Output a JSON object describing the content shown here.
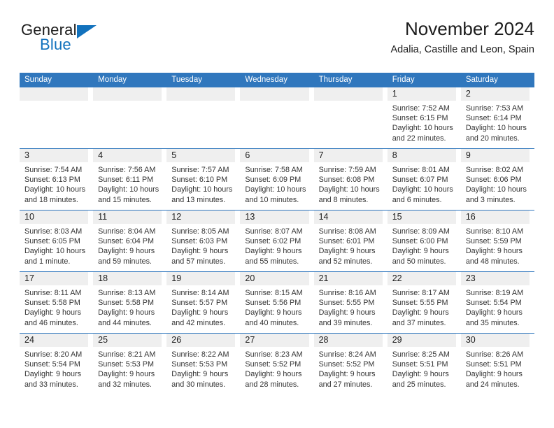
{
  "brand": {
    "name_part1": "General",
    "name_part2": "Blue",
    "accent_color": "#1272bd"
  },
  "header": {
    "title": "November 2024",
    "subtitle": "Adalia, Castille and Leon, Spain"
  },
  "calendar": {
    "header_bg": "#3077bd",
    "daynum_bg": "#efefef",
    "day_names": [
      "Sunday",
      "Monday",
      "Tuesday",
      "Wednesday",
      "Thursday",
      "Friday",
      "Saturday"
    ],
    "weeks": [
      [
        {
          "empty": true
        },
        {
          "empty": true
        },
        {
          "empty": true
        },
        {
          "empty": true
        },
        {
          "empty": true
        },
        {
          "day": "1",
          "sunrise": "Sunrise: 7:52 AM",
          "sunset": "Sunset: 6:15 PM",
          "daylight1": "Daylight: 10 hours",
          "daylight2": "and 22 minutes."
        },
        {
          "day": "2",
          "sunrise": "Sunrise: 7:53 AM",
          "sunset": "Sunset: 6:14 PM",
          "daylight1": "Daylight: 10 hours",
          "daylight2": "and 20 minutes."
        }
      ],
      [
        {
          "day": "3",
          "sunrise": "Sunrise: 7:54 AM",
          "sunset": "Sunset: 6:13 PM",
          "daylight1": "Daylight: 10 hours",
          "daylight2": "and 18 minutes."
        },
        {
          "day": "4",
          "sunrise": "Sunrise: 7:56 AM",
          "sunset": "Sunset: 6:11 PM",
          "daylight1": "Daylight: 10 hours",
          "daylight2": "and 15 minutes."
        },
        {
          "day": "5",
          "sunrise": "Sunrise: 7:57 AM",
          "sunset": "Sunset: 6:10 PM",
          "daylight1": "Daylight: 10 hours",
          "daylight2": "and 13 minutes."
        },
        {
          "day": "6",
          "sunrise": "Sunrise: 7:58 AM",
          "sunset": "Sunset: 6:09 PM",
          "daylight1": "Daylight: 10 hours",
          "daylight2": "and 10 minutes."
        },
        {
          "day": "7",
          "sunrise": "Sunrise: 7:59 AM",
          "sunset": "Sunset: 6:08 PM",
          "daylight1": "Daylight: 10 hours",
          "daylight2": "and 8 minutes."
        },
        {
          "day": "8",
          "sunrise": "Sunrise: 8:01 AM",
          "sunset": "Sunset: 6:07 PM",
          "daylight1": "Daylight: 10 hours",
          "daylight2": "and 6 minutes."
        },
        {
          "day": "9",
          "sunrise": "Sunrise: 8:02 AM",
          "sunset": "Sunset: 6:06 PM",
          "daylight1": "Daylight: 10 hours",
          "daylight2": "and 3 minutes."
        }
      ],
      [
        {
          "day": "10",
          "sunrise": "Sunrise: 8:03 AM",
          "sunset": "Sunset: 6:05 PM",
          "daylight1": "Daylight: 10 hours",
          "daylight2": "and 1 minute."
        },
        {
          "day": "11",
          "sunrise": "Sunrise: 8:04 AM",
          "sunset": "Sunset: 6:04 PM",
          "daylight1": "Daylight: 9 hours",
          "daylight2": "and 59 minutes."
        },
        {
          "day": "12",
          "sunrise": "Sunrise: 8:05 AM",
          "sunset": "Sunset: 6:03 PM",
          "daylight1": "Daylight: 9 hours",
          "daylight2": "and 57 minutes."
        },
        {
          "day": "13",
          "sunrise": "Sunrise: 8:07 AM",
          "sunset": "Sunset: 6:02 PM",
          "daylight1": "Daylight: 9 hours",
          "daylight2": "and 55 minutes."
        },
        {
          "day": "14",
          "sunrise": "Sunrise: 8:08 AM",
          "sunset": "Sunset: 6:01 PM",
          "daylight1": "Daylight: 9 hours",
          "daylight2": "and 52 minutes."
        },
        {
          "day": "15",
          "sunrise": "Sunrise: 8:09 AM",
          "sunset": "Sunset: 6:00 PM",
          "daylight1": "Daylight: 9 hours",
          "daylight2": "and 50 minutes."
        },
        {
          "day": "16",
          "sunrise": "Sunrise: 8:10 AM",
          "sunset": "Sunset: 5:59 PM",
          "daylight1": "Daylight: 9 hours",
          "daylight2": "and 48 minutes."
        }
      ],
      [
        {
          "day": "17",
          "sunrise": "Sunrise: 8:11 AM",
          "sunset": "Sunset: 5:58 PM",
          "daylight1": "Daylight: 9 hours",
          "daylight2": "and 46 minutes."
        },
        {
          "day": "18",
          "sunrise": "Sunrise: 8:13 AM",
          "sunset": "Sunset: 5:58 PM",
          "daylight1": "Daylight: 9 hours",
          "daylight2": "and 44 minutes."
        },
        {
          "day": "19",
          "sunrise": "Sunrise: 8:14 AM",
          "sunset": "Sunset: 5:57 PM",
          "daylight1": "Daylight: 9 hours",
          "daylight2": "and 42 minutes."
        },
        {
          "day": "20",
          "sunrise": "Sunrise: 8:15 AM",
          "sunset": "Sunset: 5:56 PM",
          "daylight1": "Daylight: 9 hours",
          "daylight2": "and 40 minutes."
        },
        {
          "day": "21",
          "sunrise": "Sunrise: 8:16 AM",
          "sunset": "Sunset: 5:55 PM",
          "daylight1": "Daylight: 9 hours",
          "daylight2": "and 39 minutes."
        },
        {
          "day": "22",
          "sunrise": "Sunrise: 8:17 AM",
          "sunset": "Sunset: 5:55 PM",
          "daylight1": "Daylight: 9 hours",
          "daylight2": "and 37 minutes."
        },
        {
          "day": "23",
          "sunrise": "Sunrise: 8:19 AM",
          "sunset": "Sunset: 5:54 PM",
          "daylight1": "Daylight: 9 hours",
          "daylight2": "and 35 minutes."
        }
      ],
      [
        {
          "day": "24",
          "sunrise": "Sunrise: 8:20 AM",
          "sunset": "Sunset: 5:54 PM",
          "daylight1": "Daylight: 9 hours",
          "daylight2": "and 33 minutes."
        },
        {
          "day": "25",
          "sunrise": "Sunrise: 8:21 AM",
          "sunset": "Sunset: 5:53 PM",
          "daylight1": "Daylight: 9 hours",
          "daylight2": "and 32 minutes."
        },
        {
          "day": "26",
          "sunrise": "Sunrise: 8:22 AM",
          "sunset": "Sunset: 5:53 PM",
          "daylight1": "Daylight: 9 hours",
          "daylight2": "and 30 minutes."
        },
        {
          "day": "27",
          "sunrise": "Sunrise: 8:23 AM",
          "sunset": "Sunset: 5:52 PM",
          "daylight1": "Daylight: 9 hours",
          "daylight2": "and 28 minutes."
        },
        {
          "day": "28",
          "sunrise": "Sunrise: 8:24 AM",
          "sunset": "Sunset: 5:52 PM",
          "daylight1": "Daylight: 9 hours",
          "daylight2": "and 27 minutes."
        },
        {
          "day": "29",
          "sunrise": "Sunrise: 8:25 AM",
          "sunset": "Sunset: 5:51 PM",
          "daylight1": "Daylight: 9 hours",
          "daylight2": "and 25 minutes."
        },
        {
          "day": "30",
          "sunrise": "Sunrise: 8:26 AM",
          "sunset": "Sunset: 5:51 PM",
          "daylight1": "Daylight: 9 hours",
          "daylight2": "and 24 minutes."
        }
      ]
    ]
  }
}
